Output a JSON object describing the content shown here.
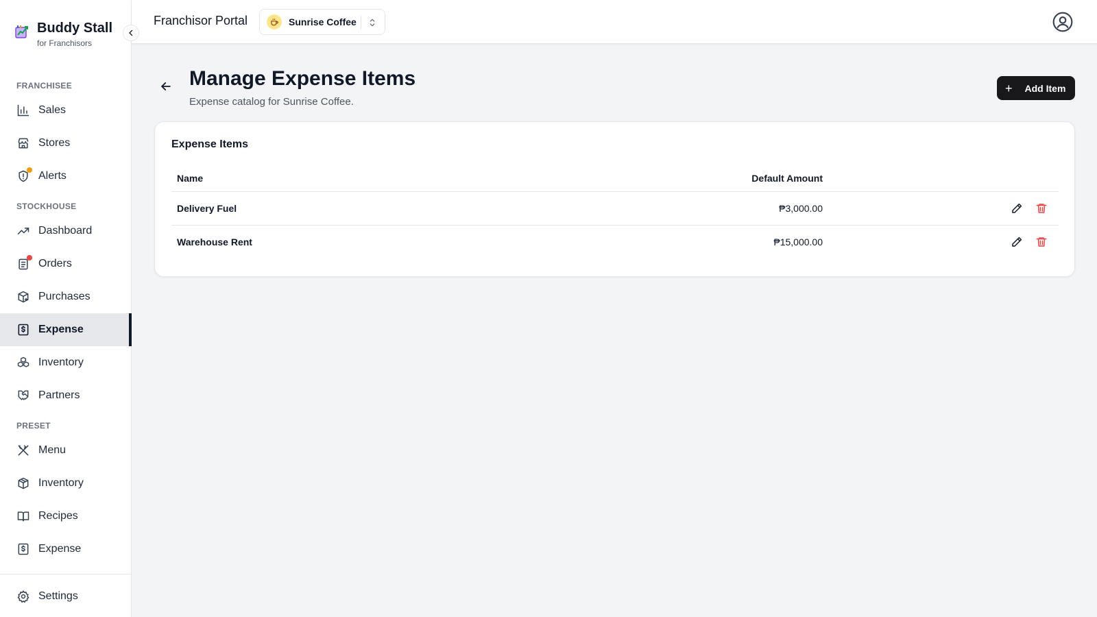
{
  "brand": {
    "name": "Buddy Stall",
    "subtitle": "for Franchisors"
  },
  "sidebar": {
    "sections": {
      "franchisee": "FRANCHISEE",
      "stockhouse": "STOCKHOUSE",
      "preset": "PRESET"
    },
    "items": {
      "sales": "Sales",
      "stores": "Stores",
      "alerts": "Alerts",
      "dashboard": "Dashboard",
      "orders": "Orders",
      "purchases": "Purchases",
      "expense": "Expense",
      "inventory": "Inventory",
      "partners": "Partners",
      "menu": "Menu",
      "preset_inventory": "Inventory",
      "recipes": "Recipes",
      "preset_expense": "Expense",
      "settings": "Settings"
    },
    "active": "expense"
  },
  "topbar": {
    "title": "Franchisor Portal",
    "store": "Sunrise Coffee"
  },
  "page": {
    "title": "Manage Expense Items",
    "subtitle": "Expense catalog for Sunrise Coffee.",
    "add_button": "Add Item"
  },
  "card": {
    "title": "Expense Items",
    "columns": {
      "name": "Name",
      "amount": "Default Amount"
    },
    "rows": [
      {
        "name": "Delivery Fuel",
        "amount": "₱3,000.00"
      },
      {
        "name": "Warehouse Rent",
        "amount": "₱15,000.00"
      }
    ]
  },
  "colors": {
    "primary": "#18181b",
    "danger": "#ef4444",
    "alert_dot": "#f59e0b",
    "order_dot": "#ef4444"
  }
}
